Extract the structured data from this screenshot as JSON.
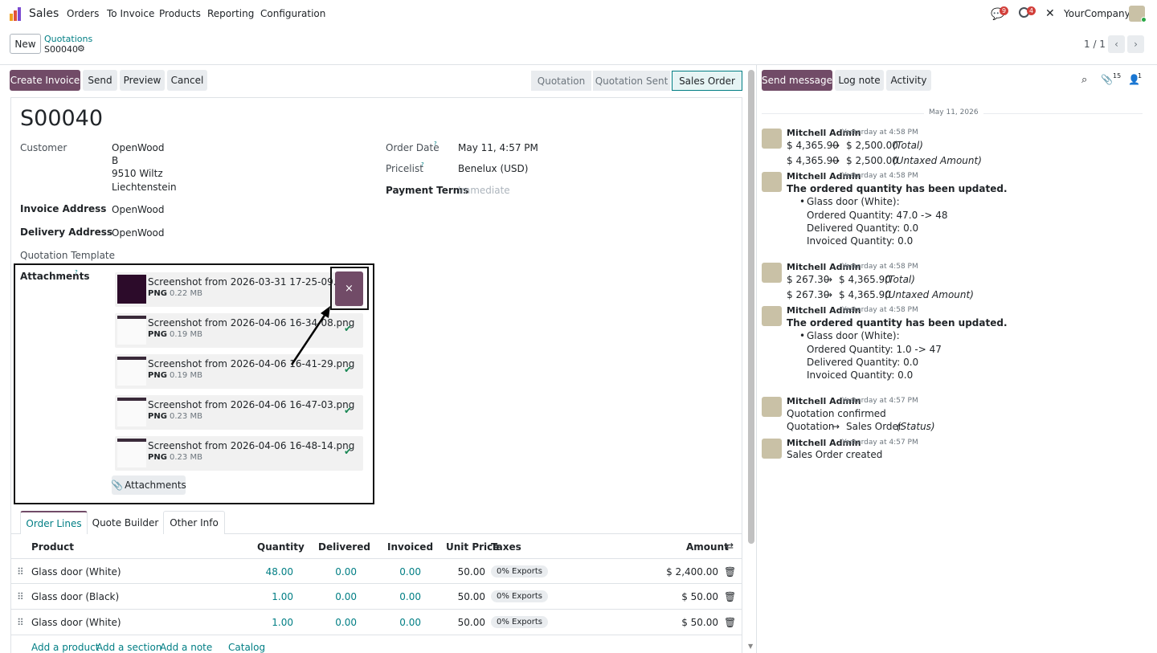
{
  "topnav": {
    "app": "Sales",
    "menu": [
      "Orders",
      "To Invoice",
      "Products",
      "Reporting",
      "Configuration"
    ],
    "messages_count": "9",
    "activities_count": "4",
    "company": "YourCompany"
  },
  "control": {
    "new_label": "New",
    "breadcrumb_parent": "Quotations",
    "record_name": "S00040",
    "pager": "1 / 1"
  },
  "actions": {
    "create_invoice": "Create Invoice",
    "send": "Send",
    "preview": "Preview",
    "cancel": "Cancel"
  },
  "statusbar": {
    "stages": [
      "Quotation",
      "Quotation Sent",
      "Sales Order"
    ],
    "current": "Sales Order"
  },
  "form": {
    "title": "S00040",
    "customer_label": "Customer",
    "customer_name": "OpenWood",
    "customer_addr": [
      "B",
      "9510 Wiltz",
      "Liechtenstein"
    ],
    "invoice_address_label": "Invoice Address",
    "invoice_address": "OpenWood",
    "delivery_address_label": "Delivery Address",
    "delivery_address": "OpenWood",
    "quotation_template_label": "Quotation Template",
    "order_date_label": "Order Date",
    "order_date": "May 11, 4:57 PM",
    "pricelist_label": "Pricelist",
    "pricelist": "Benelux (USD)",
    "payment_terms_label": "Payment Terms",
    "payment_terms_placeholder": "Immediate",
    "attachments_label": "Attachments",
    "help_mark": "?",
    "attachments": [
      {
        "name": "Screenshot from 2026-03-31 17-25-09.png",
        "type": "PNG",
        "size": "0.22 MB"
      },
      {
        "name": "Screenshot from 2026-04-06 16-34-08.png",
        "type": "PNG",
        "size": "0.19 MB"
      },
      {
        "name": "Screenshot from 2026-04-06 16-41-29.png",
        "type": "PNG",
        "size": "0.19 MB"
      },
      {
        "name": "Screenshot from 2026-04-06 16-47-03.png",
        "type": "PNG",
        "size": "0.23 MB"
      },
      {
        "name": "Screenshot from 2026-04-06 16-48-14.png",
        "type": "PNG",
        "size": "0.23 MB"
      }
    ],
    "attachments_button": "Attachments"
  },
  "tabs": [
    "Order Lines",
    "Quote Builder",
    "Other Info"
  ],
  "order_lines": {
    "headers": {
      "product": "Product",
      "quantity": "Quantity",
      "delivered": "Delivered",
      "invoiced": "Invoiced",
      "unit_price": "Unit Price",
      "taxes": "Taxes",
      "amount": "Amount"
    },
    "rows": [
      {
        "product": "Glass door (White)",
        "quantity": "48.00",
        "delivered": "0.00",
        "invoiced": "0.00",
        "unit_price": "50.00",
        "tax": "0% Exports",
        "amount": "$ 2,400.00"
      },
      {
        "product": "Glass door (Black)",
        "quantity": "1.00",
        "delivered": "0.00",
        "invoiced": "0.00",
        "unit_price": "50.00",
        "tax": "0% Exports",
        "amount": "$ 50.00"
      },
      {
        "product": "Glass door (White)",
        "quantity": "1.00",
        "delivered": "0.00",
        "invoiced": "0.00",
        "unit_price": "50.00",
        "tax": "0% Exports",
        "amount": "$ 50.00"
      }
    ],
    "add_links": [
      "Add a product",
      "Add a section",
      "Add a note",
      "Catalog"
    ]
  },
  "chatter": {
    "send_message": "Send message",
    "log_note": "Log note",
    "activity": "Activity",
    "attachments_count": "15",
    "followers_count": "1",
    "date_separator": "May 11, 2026",
    "messages": [
      {
        "author": "Mitchell Admin",
        "time": "Yesterday at 4:58 PM",
        "changes": [
          {
            "old": "$ 4,365.90",
            "new": "$ 2,500.00",
            "field": "(Total)"
          },
          {
            "old": "$ 4,365.90",
            "new": "$ 2,500.00",
            "field": "(Untaxed Amount)"
          }
        ]
      },
      {
        "author": "Mitchell Admin",
        "time": "Yesterday at 4:58 PM",
        "bold": "The ordered quantity has been updated.",
        "bullet": "Glass door (White):",
        "details": [
          "Ordered Quantity: 47.0 -> 48",
          "Delivered Quantity: 0.0",
          "Invoiced Quantity: 0.0"
        ]
      },
      {
        "author": "Mitchell Admin",
        "time": "Yesterday at 4:58 PM",
        "changes": [
          {
            "old": "$ 267.30",
            "new": "$ 4,365.90",
            "field": "(Total)"
          },
          {
            "old": "$ 267.30",
            "new": "$ 4,365.90",
            "field": "(Untaxed Amount)"
          }
        ]
      },
      {
        "author": "Mitchell Admin",
        "time": "Yesterday at 4:58 PM",
        "bold": "The ordered quantity has been updated.",
        "bullet": "Glass door (White):",
        "details": [
          "Ordered Quantity: 1.0 -> 47",
          "Delivered Quantity: 0.0",
          "Invoiced Quantity: 0.0"
        ]
      },
      {
        "author": "Mitchell Admin",
        "time": "Yesterday at 4:57 PM",
        "text": "Quotation confirmed",
        "changes": [
          {
            "old": "Quotation",
            "new": "Sales Order",
            "field": "(Status)"
          }
        ]
      },
      {
        "author": "Mitchell Admin",
        "time": "Yesterday at 4:57 PM",
        "text": "Sales Order created"
      }
    ]
  },
  "icons": {
    "delete_attachment": "×",
    "check": "✔",
    "arrow": "→",
    "trash": "trash-icon"
  },
  "colors": {
    "primary": "#714b67",
    "link": "#017e84",
    "success": "#198754"
  }
}
